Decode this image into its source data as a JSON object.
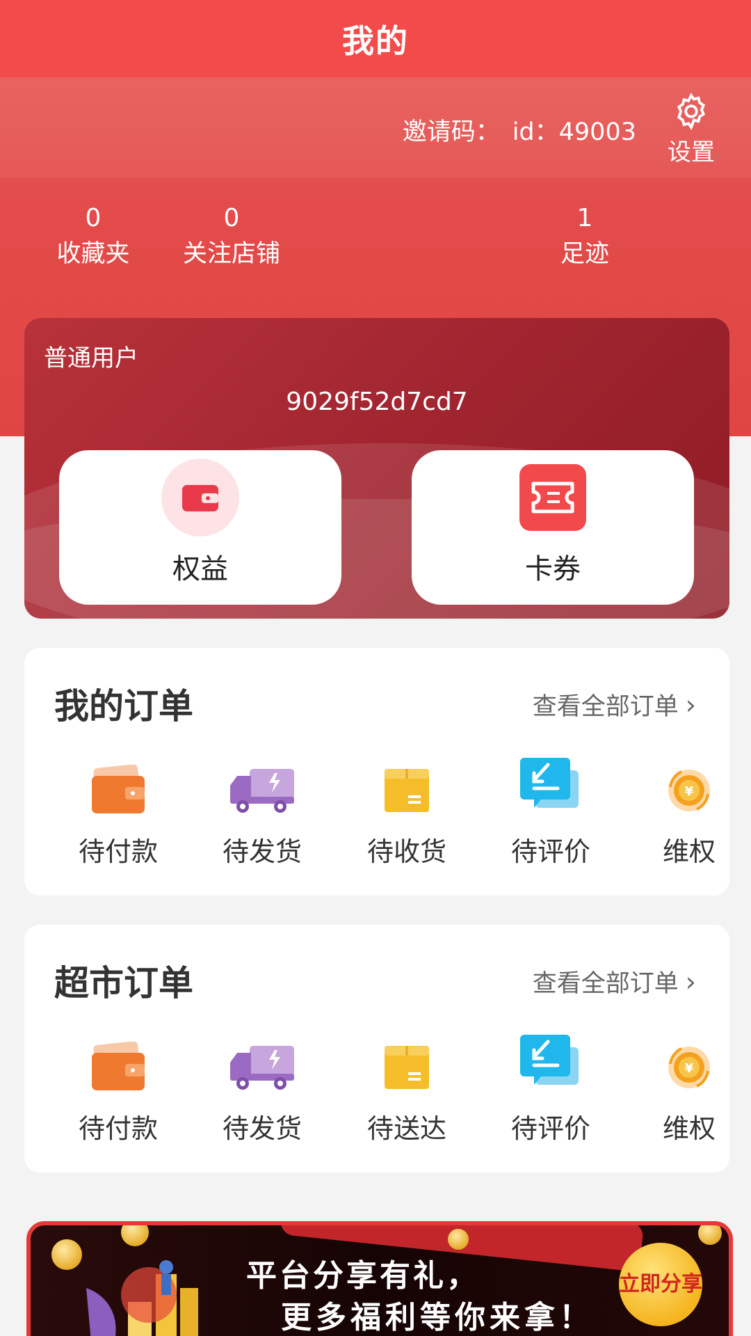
{
  "header": {
    "title": "我的"
  },
  "profile": {
    "invite_label": "邀请码：",
    "invite_value": "id：49003",
    "settings_label": "设置"
  },
  "stats": [
    {
      "value": "0",
      "label": "收藏夹"
    },
    {
      "value": "0",
      "label": "关注店铺"
    },
    {
      "value": "1",
      "label": "足迹"
    }
  ],
  "member_card": {
    "level": "普通用户",
    "code": "9029f52d7cd7",
    "buttons": [
      {
        "label": "权益",
        "icon": "wallet-icon"
      },
      {
        "label": "卡券",
        "icon": "coupon-icon"
      }
    ]
  },
  "my_orders": {
    "title": "我的订单",
    "view_all": "查看全部订单",
    "items": [
      {
        "label": "待付款",
        "icon": "wallet-icon"
      },
      {
        "label": "待发货",
        "icon": "truck-icon"
      },
      {
        "label": "待收货",
        "icon": "box-icon"
      },
      {
        "label": "待评价",
        "icon": "comment-icon"
      },
      {
        "label": "维权",
        "icon": "yuan-coin-icon"
      }
    ]
  },
  "market_orders": {
    "title": "超市订单",
    "view_all": "查看全部订单",
    "items": [
      {
        "label": "待付款",
        "icon": "wallet-icon"
      },
      {
        "label": "待发货",
        "icon": "truck-icon"
      },
      {
        "label": "待送达",
        "icon": "box-icon"
      },
      {
        "label": "待评价",
        "icon": "comment-icon"
      },
      {
        "label": "维权",
        "icon": "yuan-coin-icon"
      }
    ]
  },
  "banner": {
    "line1": "平台分享有礼，",
    "line2": "更多福利等你来拿！",
    "cta": "立即分享"
  },
  "colors": {
    "brand_red": "#f34b4a",
    "card_red": "#a32631"
  }
}
